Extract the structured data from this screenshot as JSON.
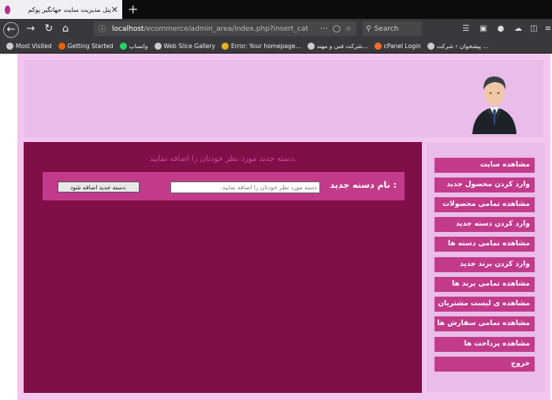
{
  "browser": {
    "tab_title": "پنل مدیریت سایت جهانگیر پوکم",
    "tab_close": "✕",
    "new_tab": "+",
    "url_host": "localhost",
    "url_path": "/ecommerce/admin_area/index.php?insert_cat",
    "search_placeholder": "Search",
    "bookmarks": [
      {
        "label": "Most Visited",
        "icon_color": "#cccccc"
      },
      {
        "label": "Getting Started",
        "icon_color": "#e66000"
      },
      {
        "label": "واتساپ",
        "icon_color": "#25d366"
      },
      {
        "label": "Web Slice Gallery",
        "icon_color": "#cccccc"
      },
      {
        "label": "Error: Your homepage...",
        "icon_color": "#e8b21e"
      },
      {
        "label": "شرکت فنی و مهند...",
        "icon_color": "#cccccc"
      },
      {
        "label": "cPanel Login",
        "icon_color": "#ff6c2c"
      },
      {
        "label": "پیشخوان ‹ شرکت ...",
        "icon_color": "#cccccc"
      }
    ]
  },
  "main": {
    "notice": "دسته جدید مورد نظر خودتان را اضافه نمایید.",
    "form_label": "نام دسته جدید :",
    "input_placeholder": "دسته مورد نظر خودتان را اضافه نمایید.",
    "submit_label": "دسته جدید اضافه شود."
  },
  "sidebar": {
    "items": [
      "مشاهده سایت",
      "وارد کردن محصول جدید",
      "مشاهده تمامی محصولات",
      "وارد کردن دسته جدید",
      "مشاهده تمامی دسته ها",
      "وارد کردن برند جدید",
      "مشاهده تمامی برند ها",
      "مشاهده ی لیست مشتریان",
      "مشاهده تمامی سفارش ها",
      "مشاهده پرداخت ها",
      "خروج"
    ]
  },
  "colors": {
    "main_bg": "#800e47",
    "accent": "#c23b8b",
    "panel_bg": "#e9bce9"
  }
}
